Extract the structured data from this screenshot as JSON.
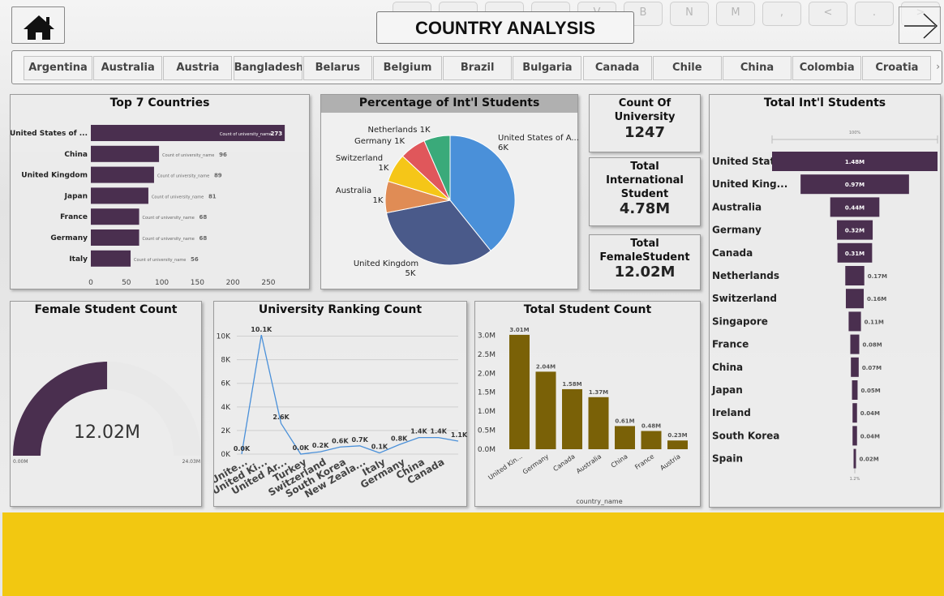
{
  "header": {
    "title": "COUNTRY ANALYSIS",
    "keyboard_keys": [
      "",
      "",
      "",
      "",
      "V",
      "B",
      "N",
      "M",
      ",",
      "<",
      ".",
      ">"
    ]
  },
  "slicer": {
    "countries": [
      "Argentina",
      "Australia",
      "Austria",
      "Bangladesh",
      "Belarus",
      "Belgium",
      "Brazil",
      "Bulgaria",
      "Canada",
      "Chile",
      "China",
      "Colombia",
      "Croatia"
    ]
  },
  "kpis": {
    "count_of_university": {
      "title": "Count Of University",
      "value": "1247"
    },
    "total_international_student": {
      "title": "Total International Student",
      "value": "4.78M"
    },
    "total_female_student": {
      "title": "Total FemaleStudent",
      "value": "12.02M"
    }
  },
  "colors": {
    "plum": "#4a2f4f",
    "olive": "#7a6107",
    "line": "#4a90d9",
    "footer": "#f2c811"
  },
  "chart_data": [
    {
      "id": "top7",
      "type": "bar",
      "orientation": "horizontal",
      "title": "Top 7 Countries",
      "categories": [
        "United States of ...",
        "China",
        "United Kingdom",
        "Japan",
        "France",
        "Germany",
        "Italy"
      ],
      "values": [
        273,
        96,
        89,
        81,
        68,
        68,
        56
      ],
      "data_label_prefix": "Count of university_name",
      "xticks": [
        0,
        50,
        100,
        150,
        200,
        250
      ],
      "xlim": [
        0,
        290
      ]
    },
    {
      "id": "pie",
      "type": "pie",
      "title": "Percentage of Int'l Students",
      "slices": [
        {
          "label": "United States of A...",
          "value_label": "6K",
          "value": 6,
          "color": "#4a90d9"
        },
        {
          "label": "United Kingdom",
          "value_label": "5K",
          "value": 5,
          "color": "#4a5a8a"
        },
        {
          "label": "Australia",
          "value_label": "1K",
          "value": 1.2,
          "color": "#e08c55"
        },
        {
          "label": "Switzerland",
          "value_label": "1K",
          "value": 1.1,
          "color": "#f5c618"
        },
        {
          "label": "Germany",
          "value_label": "1K",
          "value": 1.0,
          "color": "#e0575b"
        },
        {
          "label": "Netherlands",
          "value_label": "1K",
          "value": 1.0,
          "color": "#3aaa7a"
        }
      ]
    },
    {
      "id": "gauge",
      "type": "gauge",
      "title": "Female Student Count",
      "value": 12.02,
      "value_label": "12.02M",
      "min_label": "0.00M",
      "max_label": "24.03M",
      "max": 24.03
    },
    {
      "id": "ranking",
      "type": "line",
      "title": "University Ranking Count",
      "categories": [
        "Unite...",
        "United Ki...",
        "United Ar...",
        "Turkey",
        "Switzerland",
        "South Korea",
        "New Zeala...",
        "Italy",
        "Germany",
        "China",
        "Canada"
      ],
      "values": [
        0.0,
        10.1,
        2.6,
        0.0,
        0.2,
        0.6,
        0.7,
        0.1,
        0.8,
        1.4,
        1.4,
        1.1
      ],
      "labels": [
        "0.0K",
        "10.1K",
        "2.6K",
        "0.0K",
        "0.2K",
        "0.6K",
        "0.7K",
        "0.1K",
        "0.8K",
        "1.4K",
        "1.4K",
        "1.1K"
      ],
      "yticks": [
        "0K",
        "2K",
        "4K",
        "6K",
        "8K",
        "10K"
      ],
      "ylim": [
        0,
        11
      ]
    },
    {
      "id": "total",
      "type": "bar",
      "title": "Total Student Count",
      "categories": [
        "United Kin...",
        "Germany",
        "Canada",
        "Australia",
        "China",
        "France",
        "Austria"
      ],
      "values": [
        3.01,
        2.04,
        1.58,
        1.37,
        0.61,
        0.48,
        0.23
      ],
      "labels": [
        "3.01M",
        "2.04M",
        "1.58M",
        "1.37M",
        "0.61M",
        "0.48M",
        "0.23M"
      ],
      "yticks": [
        "0.0M",
        "0.5M",
        "1.0M",
        "1.5M",
        "2.0M",
        "2.5M",
        "3.0M"
      ],
      "ylim": [
        0,
        3.2
      ],
      "xlabel": "country_name"
    },
    {
      "id": "funnel",
      "type": "bar",
      "orientation": "funnel",
      "title": "Total Int'l Students",
      "categories": [
        "United Stat...",
        "United King...",
        "Australia",
        "Germany",
        "Canada",
        "Netherlands",
        "Switzerland",
        "Singapore",
        "France",
        "China",
        "Japan",
        "Ireland",
        "South Korea",
        "Spain"
      ],
      "values": [
        1.48,
        0.97,
        0.44,
        0.32,
        0.31,
        0.17,
        0.16,
        0.11,
        0.08,
        0.07,
        0.05,
        0.04,
        0.04,
        0.02
      ],
      "labels": [
        "1.48M",
        "0.97M",
        "0.44M",
        "0.32M",
        "0.31M",
        "0.17M",
        "0.16M",
        "0.11M",
        "0.08M",
        "0.07M",
        "0.05M",
        "0.04M",
        "0.04M",
        "0.02M"
      ],
      "top_pct": "100%",
      "bottom_pct": "1.2%"
    }
  ]
}
